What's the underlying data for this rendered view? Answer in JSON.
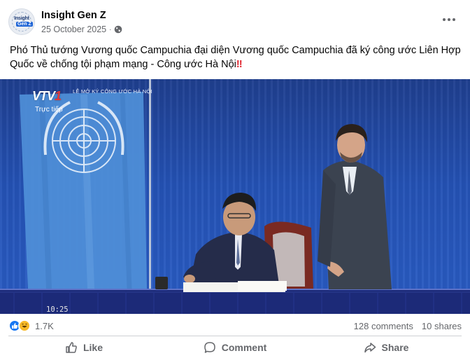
{
  "post": {
    "page_name": "Insight Gen Z",
    "date": "25 October 2025",
    "privacy_icon": "globe-icon",
    "avatar_line1": "Insight",
    "avatar_line2": "Gen Z",
    "caption": "Phó Thủ tướng Vương quốc Campuchia đại diện Vương quốc Campuchia đã ký công ước Liên Hợp Quốc về chống tội phạm mạng - Công ước Hà Nội",
    "caption_emoji": "‼"
  },
  "media": {
    "broadcaster": "VTV",
    "broadcaster_number": "1",
    "live_label": "Trực tiếp",
    "event_caption": "LỄ MỞ KÝ CÔNG ƯỚC HÀ NỘI",
    "clock": "10:25"
  },
  "stats": {
    "reaction_icons": [
      "like-icon",
      "haha-icon"
    ],
    "reaction_count": "1.7K",
    "comments": "128 comments",
    "shares": "10 shares"
  },
  "actions": {
    "like": "Like",
    "comment": "Comment",
    "share": "Share"
  },
  "colors": {
    "accent": "#1877f2",
    "text_secondary": "#65676b",
    "backdrop_blue": "#2452b5",
    "un_flag": "#4f8fd8"
  }
}
